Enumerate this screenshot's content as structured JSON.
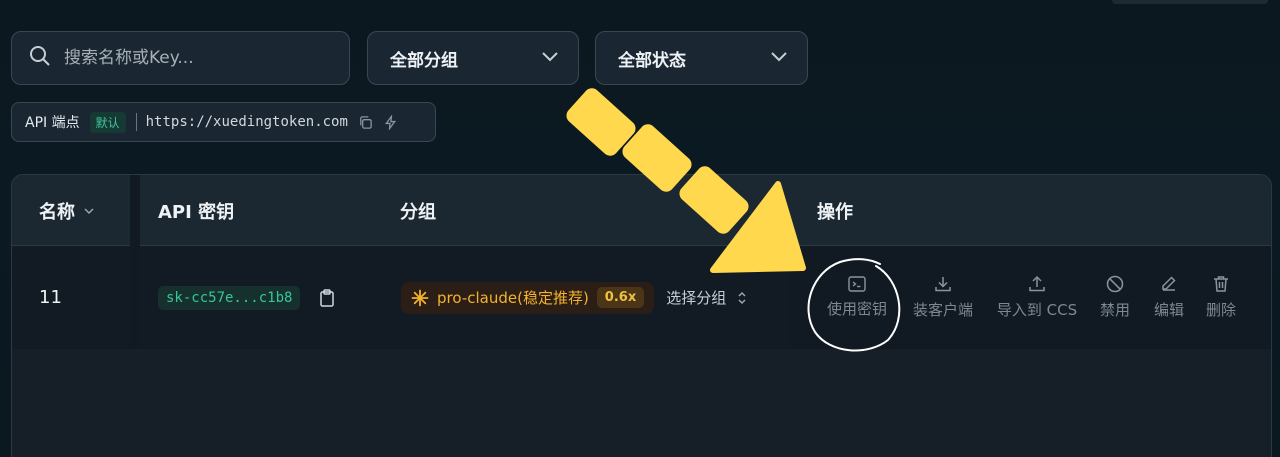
{
  "search": {
    "placeholder": "搜索名称或Key..."
  },
  "filters": {
    "group": "全部分组",
    "status": "全部状态"
  },
  "endpoint": {
    "label": "API 端点",
    "badge": "默认",
    "url": "https://xuedingtoken.com"
  },
  "table": {
    "headers": {
      "name": "名称",
      "key": "API 密钥",
      "group": "分组",
      "actions": "操作"
    },
    "rows": [
      {
        "name": "11",
        "key": "sk-cc57e...c1b8",
        "group": "pro-claude(稳定推荐)",
        "ratio": "0.6x",
        "choose": "选择分组"
      }
    ]
  },
  "actions": {
    "use_key": "使用密钥",
    "install_client": "装客户端",
    "import_ccs": "导入到 CCS",
    "disable": "禁用",
    "edit": "编辑",
    "delete": "删除"
  },
  "colors": {
    "accent_green": "#38c59a",
    "group_orange": "#f4b22c",
    "arrow_yellow": "#ffd84d"
  }
}
